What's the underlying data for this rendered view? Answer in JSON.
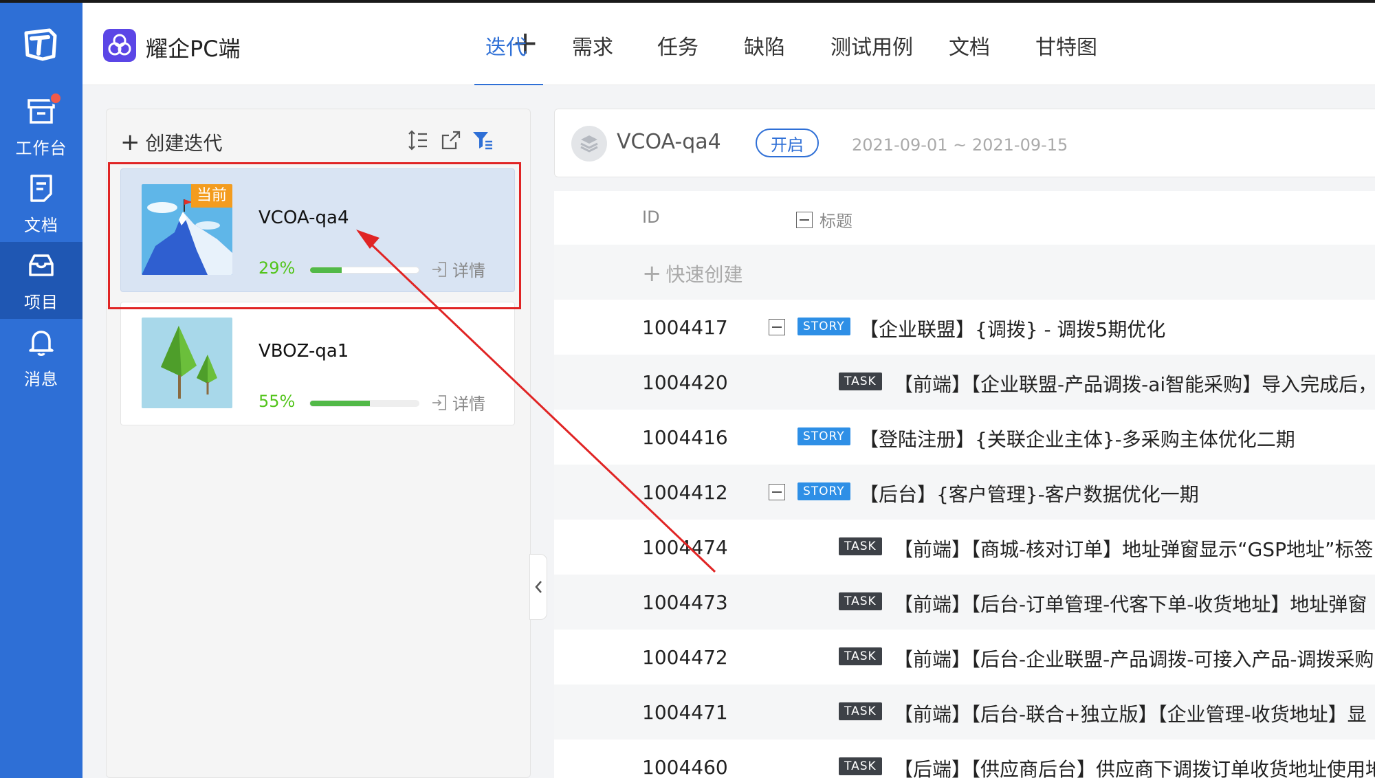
{
  "rail": {
    "items": [
      {
        "label": "工作台",
        "icon": "inbox-tray-icon",
        "has_badge": true
      },
      {
        "label": "文档",
        "icon": "document-icon"
      },
      {
        "label": "项目",
        "icon": "project-box-icon",
        "active": true
      },
      {
        "label": "消息",
        "icon": "bell-icon"
      }
    ]
  },
  "header": {
    "brand": "耀企PC端",
    "add_icon": "plus-icon",
    "tabs": [
      {
        "label": "迭代",
        "active": true
      },
      {
        "label": "需求"
      },
      {
        "label": "任务"
      },
      {
        "label": "缺陷"
      },
      {
        "label": "测试用例"
      },
      {
        "label": "文档"
      },
      {
        "label": "甘特图"
      }
    ]
  },
  "left_panel": {
    "create_label": "创建迭代",
    "iterations": [
      {
        "name": "VCOA-qa4",
        "progress_label": "29%",
        "progress": 0.29,
        "tag": "当前",
        "detail": "详情",
        "current": true
      },
      {
        "name": "VBOZ-qa1",
        "progress_label": "55%",
        "progress": 0.55,
        "detail": "详情",
        "current": false
      }
    ]
  },
  "project": {
    "name": "VCOA-qa4",
    "status": "开启",
    "dates": "2021-09-01 ~ 2021-09-15"
  },
  "table": {
    "col_id": "ID",
    "col_title": "标题",
    "quick_create": "快速创建",
    "rows": [
      {
        "id": "1004417",
        "type": "STORY",
        "expand": true,
        "title": "【企业联盟】{调拨} - 调拨5期优化"
      },
      {
        "id": "1004420",
        "type": "TASK",
        "expand": false,
        "title": "【前端】【企业联盟-产品调拨-ai智能采购】导入完成后，"
      },
      {
        "id": "1004416",
        "type": "STORY",
        "expand": false,
        "title": "【登陆注册】{关联企业主体}-多采购主体优化二期"
      },
      {
        "id": "1004412",
        "type": "STORY",
        "expand": true,
        "title": "【后台】{客户管理}-客户数据优化一期"
      },
      {
        "id": "1004474",
        "type": "TASK",
        "expand": false,
        "title": "【前端】【商城-核对订单】地址弹窗显示“GSP地址”标签"
      },
      {
        "id": "1004473",
        "type": "TASK",
        "expand": false,
        "title": "【前端】【后台-订单管理-代客下单-收货地址】地址弹窗"
      },
      {
        "id": "1004472",
        "type": "TASK",
        "expand": false,
        "title": "【前端】【后台-企业联盟-产品调拨-可接入产品-调拨采购"
      },
      {
        "id": "1004471",
        "type": "TASK",
        "expand": false,
        "title": "【前端】【后台-联合+独立版】【企业管理-收货地址】显"
      },
      {
        "id": "1004460",
        "type": "TASK",
        "expand": false,
        "title": "【后端】【供应商后台】供应商下调拨订单收货地址使用地"
      }
    ]
  },
  "colors": {
    "rail": "#2e6fd6",
    "accent": "#2e6fd6",
    "progress": "#52b948",
    "current_tag": "#f39c1f",
    "annotation": "#e02424"
  }
}
